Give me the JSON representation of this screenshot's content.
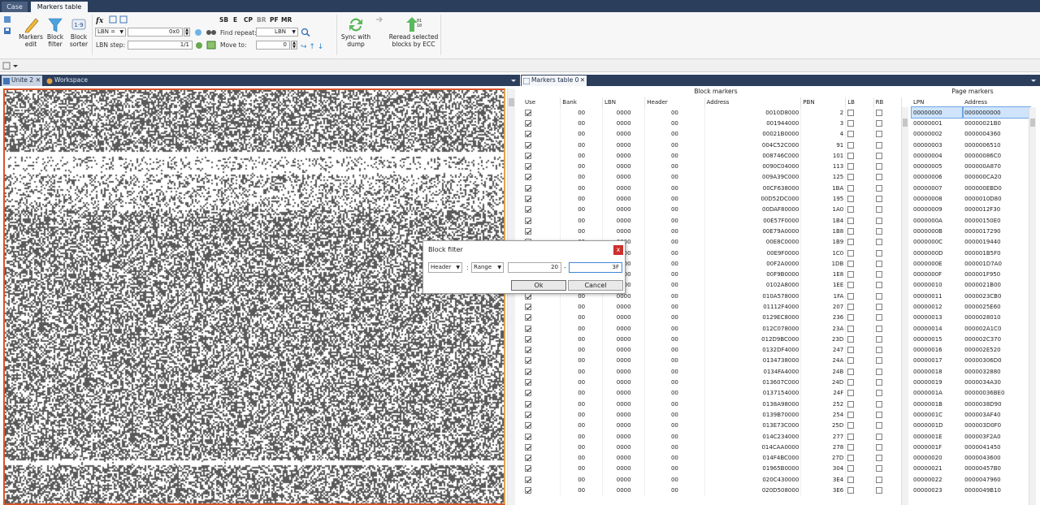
{
  "tabs": {
    "case": "Case",
    "markers_table": "Markers table"
  },
  "ribbon": {
    "markers_edit": "Markers edit",
    "block_filter": "Block filter",
    "block_sorter": "Block sorter",
    "lbn_combo": "LBN =",
    "lbn_value": "0x0",
    "lbn_step_label": "LBN step:",
    "lbn_step_value": "1/1",
    "find_repeat_label": "Find repeat:",
    "find_repeat_value": "LBN",
    "move_to_label": "Move to:",
    "move_to_value": "0",
    "sb": "SB",
    "e": "E",
    "cp": "CP",
    "br": "BR",
    "pf": "PF",
    "mr": "MR",
    "sync_with_dump": "Sync with dump",
    "reread_ecc": "Reread selected blocks by ECC"
  },
  "doc_tabs": {
    "unite": "Unite 2",
    "workspace": "Workspace",
    "markers_table0": "Markers table 0"
  },
  "block_markers": {
    "title": "Block markers",
    "columns": [
      "Use",
      "Bank",
      "LBN",
      "Header",
      "Address",
      "PBN",
      "LB",
      "RB"
    ],
    "rows": [
      [
        "00",
        "0000",
        "00",
        "0010D8000",
        "2"
      ],
      [
        "00",
        "0000",
        "00",
        "001944000",
        "3"
      ],
      [
        "00",
        "0000",
        "00",
        "00021B0000",
        "4"
      ],
      [
        "00",
        "0000",
        "00",
        "004C52C000",
        "91"
      ],
      [
        "00",
        "0000",
        "00",
        "008746C000",
        "101"
      ],
      [
        "00",
        "0000",
        "00",
        "0090C04000",
        "113"
      ],
      [
        "00",
        "0000",
        "00",
        "009A39C000",
        "125"
      ],
      [
        "00",
        "0000",
        "00",
        "00CF638000",
        "1BA"
      ],
      [
        "00",
        "0000",
        "00",
        "00D52DC000",
        "195"
      ],
      [
        "00",
        "0000",
        "00",
        "00DAF80000",
        "1A0"
      ],
      [
        "00",
        "0000",
        "00",
        "00E57F0000",
        "1B4"
      ],
      [
        "00",
        "0000",
        "00",
        "00E79A0000",
        "1B8"
      ],
      [
        "00",
        "0000",
        "00",
        "00E8C0000",
        "1B9"
      ],
      [
        "00",
        "0000",
        "00",
        "00E9F0000",
        "1C0"
      ],
      [
        "00",
        "0000",
        "00",
        "00F2A0000",
        "1DB"
      ],
      [
        "00",
        "0000",
        "00",
        "00F9B0000",
        "1E8"
      ],
      [
        "00",
        "0000",
        "00",
        "0102A8000",
        "1EE"
      ],
      [
        "00",
        "0000",
        "00",
        "010A578000",
        "1FA"
      ],
      [
        "00",
        "0000",
        "00",
        "01112F4000",
        "207"
      ],
      [
        "00",
        "0000",
        "00",
        "0129EC8000",
        "236"
      ],
      [
        "00",
        "0000",
        "00",
        "012C078000",
        "23A"
      ],
      [
        "00",
        "0000",
        "00",
        "012D9BC000",
        "23D"
      ],
      [
        "00",
        "0000",
        "00",
        "0132DF4000",
        "247"
      ],
      [
        "00",
        "0000",
        "00",
        "0134738000",
        "24A"
      ],
      [
        "00",
        "0000",
        "00",
        "0134FA4000",
        "24B"
      ],
      [
        "00",
        "0000",
        "00",
        "013607C000",
        "24D"
      ],
      [
        "00",
        "0000",
        "00",
        "0137154000",
        "24F"
      ],
      [
        "00",
        "0000",
        "00",
        "0138A98000",
        "252"
      ],
      [
        "00",
        "0000",
        "00",
        "0139B70000",
        "254"
      ],
      [
        "00",
        "0000",
        "00",
        "013E73C000",
        "25D"
      ],
      [
        "00",
        "0000",
        "00",
        "014C234000",
        "277"
      ],
      [
        "00",
        "0000",
        "00",
        "014CAA0000",
        "278"
      ],
      [
        "00",
        "0000",
        "00",
        "014F4BC000",
        "27D"
      ],
      [
        "00",
        "0000",
        "00",
        "01965B0000",
        "304"
      ],
      [
        "00",
        "0000",
        "00",
        "020C430000",
        "3E4"
      ],
      [
        "00",
        "0000",
        "00",
        "020D508000",
        "3E6"
      ]
    ]
  },
  "page_markers": {
    "title": "Page markers",
    "columns": [
      "LPN",
      "Address"
    ],
    "rows": [
      [
        "00000000",
        "0000000000"
      ],
      [
        "00000001",
        "00000021B0"
      ],
      [
        "00000002",
        "0000004360"
      ],
      [
        "00000003",
        "0000006510"
      ],
      [
        "00000004",
        "00000086C0"
      ],
      [
        "00000005",
        "000000A870"
      ],
      [
        "00000006",
        "000000CA20"
      ],
      [
        "00000007",
        "000000EBD0"
      ],
      [
        "00000008",
        "0000010D80"
      ],
      [
        "00000009",
        "0000012F30"
      ],
      [
        "0000000A",
        "00000150E0"
      ],
      [
        "0000000B",
        "0000017290"
      ],
      [
        "0000000C",
        "0000019440"
      ],
      [
        "0000000D",
        "000001B5F0"
      ],
      [
        "0000000E",
        "000001D7A0"
      ],
      [
        "0000000F",
        "000001F950"
      ],
      [
        "00000010",
        "0000021B00"
      ],
      [
        "00000011",
        "0000023CB0"
      ],
      [
        "00000012",
        "0000025E60"
      ],
      [
        "00000013",
        "0000028010"
      ],
      [
        "00000014",
        "000002A1C0"
      ],
      [
        "00000015",
        "000002C370"
      ],
      [
        "00000016",
        "000002E520"
      ],
      [
        "00000017",
        "00000306D0"
      ],
      [
        "00000018",
        "0000032880"
      ],
      [
        "00000019",
        "0000034A30"
      ],
      [
        "0000001A",
        "00000036BE0"
      ],
      [
        "0000001B",
        "0000038D90"
      ],
      [
        "0000001C",
        "000003AF40"
      ],
      [
        "0000001D",
        "000003D0F0"
      ],
      [
        "0000001E",
        "000003F2A0"
      ],
      [
        "0000001F",
        "0000041450"
      ],
      [
        "00000020",
        "0000043600"
      ],
      [
        "00000021",
        "00000457B0"
      ],
      [
        "00000022",
        "0000047960"
      ],
      [
        "00000023",
        "0000049B10"
      ]
    ]
  },
  "dialog": {
    "title": "Block filter",
    "close": "x",
    "field_combo": "Header",
    "mode_combo": "Range",
    "colon": ":",
    "from": "20",
    "dash": "-",
    "to": "3F",
    "ok": "Ok",
    "cancel": "Cancel"
  }
}
